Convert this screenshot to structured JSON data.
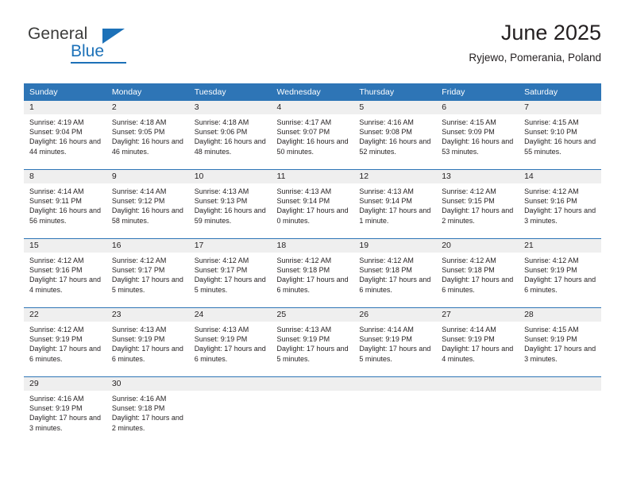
{
  "brand": {
    "name_top": "General",
    "name_bottom": "Blue",
    "accent_color": "#1c71b8",
    "triangle_icon": "triangle-icon"
  },
  "header": {
    "title": "June 2025",
    "subtitle": "Ryjewo, Pomerania, Poland"
  },
  "calendar": {
    "header_bg": "#2e75b6",
    "daynum_bg": "#efefef",
    "weekdays": [
      "Sunday",
      "Monday",
      "Tuesday",
      "Wednesday",
      "Thursday",
      "Friday",
      "Saturday"
    ],
    "weeks": [
      [
        {
          "day": "1",
          "sunrise": "Sunrise: 4:19 AM",
          "sunset": "Sunset: 9:04 PM",
          "daylight": "Daylight: 16 hours and 44 minutes."
        },
        {
          "day": "2",
          "sunrise": "Sunrise: 4:18 AM",
          "sunset": "Sunset: 9:05 PM",
          "daylight": "Daylight: 16 hours and 46 minutes."
        },
        {
          "day": "3",
          "sunrise": "Sunrise: 4:18 AM",
          "sunset": "Sunset: 9:06 PM",
          "daylight": "Daylight: 16 hours and 48 minutes."
        },
        {
          "day": "4",
          "sunrise": "Sunrise: 4:17 AM",
          "sunset": "Sunset: 9:07 PM",
          "daylight": "Daylight: 16 hours and 50 minutes."
        },
        {
          "day": "5",
          "sunrise": "Sunrise: 4:16 AM",
          "sunset": "Sunset: 9:08 PM",
          "daylight": "Daylight: 16 hours and 52 minutes."
        },
        {
          "day": "6",
          "sunrise": "Sunrise: 4:15 AM",
          "sunset": "Sunset: 9:09 PM",
          "daylight": "Daylight: 16 hours and 53 minutes."
        },
        {
          "day": "7",
          "sunrise": "Sunrise: 4:15 AM",
          "sunset": "Sunset: 9:10 PM",
          "daylight": "Daylight: 16 hours and 55 minutes."
        }
      ],
      [
        {
          "day": "8",
          "sunrise": "Sunrise: 4:14 AM",
          "sunset": "Sunset: 9:11 PM",
          "daylight": "Daylight: 16 hours and 56 minutes."
        },
        {
          "day": "9",
          "sunrise": "Sunrise: 4:14 AM",
          "sunset": "Sunset: 9:12 PM",
          "daylight": "Daylight: 16 hours and 58 minutes."
        },
        {
          "day": "10",
          "sunrise": "Sunrise: 4:13 AM",
          "sunset": "Sunset: 9:13 PM",
          "daylight": "Daylight: 16 hours and 59 minutes."
        },
        {
          "day": "11",
          "sunrise": "Sunrise: 4:13 AM",
          "sunset": "Sunset: 9:14 PM",
          "daylight": "Daylight: 17 hours and 0 minutes."
        },
        {
          "day": "12",
          "sunrise": "Sunrise: 4:13 AM",
          "sunset": "Sunset: 9:14 PM",
          "daylight": "Daylight: 17 hours and 1 minute."
        },
        {
          "day": "13",
          "sunrise": "Sunrise: 4:12 AM",
          "sunset": "Sunset: 9:15 PM",
          "daylight": "Daylight: 17 hours and 2 minutes."
        },
        {
          "day": "14",
          "sunrise": "Sunrise: 4:12 AM",
          "sunset": "Sunset: 9:16 PM",
          "daylight": "Daylight: 17 hours and 3 minutes."
        }
      ],
      [
        {
          "day": "15",
          "sunrise": "Sunrise: 4:12 AM",
          "sunset": "Sunset: 9:16 PM",
          "daylight": "Daylight: 17 hours and 4 minutes."
        },
        {
          "day": "16",
          "sunrise": "Sunrise: 4:12 AM",
          "sunset": "Sunset: 9:17 PM",
          "daylight": "Daylight: 17 hours and 5 minutes."
        },
        {
          "day": "17",
          "sunrise": "Sunrise: 4:12 AM",
          "sunset": "Sunset: 9:17 PM",
          "daylight": "Daylight: 17 hours and 5 minutes."
        },
        {
          "day": "18",
          "sunrise": "Sunrise: 4:12 AM",
          "sunset": "Sunset: 9:18 PM",
          "daylight": "Daylight: 17 hours and 6 minutes."
        },
        {
          "day": "19",
          "sunrise": "Sunrise: 4:12 AM",
          "sunset": "Sunset: 9:18 PM",
          "daylight": "Daylight: 17 hours and 6 minutes."
        },
        {
          "day": "20",
          "sunrise": "Sunrise: 4:12 AM",
          "sunset": "Sunset: 9:18 PM",
          "daylight": "Daylight: 17 hours and 6 minutes."
        },
        {
          "day": "21",
          "sunrise": "Sunrise: 4:12 AM",
          "sunset": "Sunset: 9:19 PM",
          "daylight": "Daylight: 17 hours and 6 minutes."
        }
      ],
      [
        {
          "day": "22",
          "sunrise": "Sunrise: 4:12 AM",
          "sunset": "Sunset: 9:19 PM",
          "daylight": "Daylight: 17 hours and 6 minutes."
        },
        {
          "day": "23",
          "sunrise": "Sunrise: 4:13 AM",
          "sunset": "Sunset: 9:19 PM",
          "daylight": "Daylight: 17 hours and 6 minutes."
        },
        {
          "day": "24",
          "sunrise": "Sunrise: 4:13 AM",
          "sunset": "Sunset: 9:19 PM",
          "daylight": "Daylight: 17 hours and 6 minutes."
        },
        {
          "day": "25",
          "sunrise": "Sunrise: 4:13 AM",
          "sunset": "Sunset: 9:19 PM",
          "daylight": "Daylight: 17 hours and 5 minutes."
        },
        {
          "day": "26",
          "sunrise": "Sunrise: 4:14 AM",
          "sunset": "Sunset: 9:19 PM",
          "daylight": "Daylight: 17 hours and 5 minutes."
        },
        {
          "day": "27",
          "sunrise": "Sunrise: 4:14 AM",
          "sunset": "Sunset: 9:19 PM",
          "daylight": "Daylight: 17 hours and 4 minutes."
        },
        {
          "day": "28",
          "sunrise": "Sunrise: 4:15 AM",
          "sunset": "Sunset: 9:19 PM",
          "daylight": "Daylight: 17 hours and 3 minutes."
        }
      ],
      [
        {
          "day": "29",
          "sunrise": "Sunrise: 4:16 AM",
          "sunset": "Sunset: 9:19 PM",
          "daylight": "Daylight: 17 hours and 3 minutes."
        },
        {
          "day": "30",
          "sunrise": "Sunrise: 4:16 AM",
          "sunset": "Sunset: 9:18 PM",
          "daylight": "Daylight: 17 hours and 2 minutes."
        },
        {
          "day": "",
          "sunrise": "",
          "sunset": "",
          "daylight": ""
        },
        {
          "day": "",
          "sunrise": "",
          "sunset": "",
          "daylight": ""
        },
        {
          "day": "",
          "sunrise": "",
          "sunset": "",
          "daylight": ""
        },
        {
          "day": "",
          "sunrise": "",
          "sunset": "",
          "daylight": ""
        },
        {
          "day": "",
          "sunrise": "",
          "sunset": "",
          "daylight": ""
        }
      ]
    ]
  }
}
